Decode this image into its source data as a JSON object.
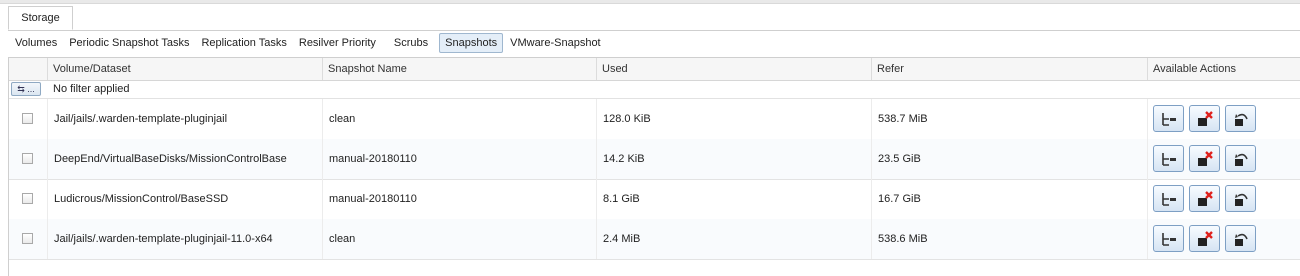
{
  "main_tab": {
    "label": "Storage"
  },
  "subtabs": [
    {
      "label": "Volumes"
    },
    {
      "label": "Periodic Snapshot Tasks"
    },
    {
      "label": "Replication Tasks"
    },
    {
      "label": "Resilver Priority"
    },
    {
      "label": "Scrubs"
    },
    {
      "label": "Snapshots",
      "active": true
    },
    {
      "label": "VMware-Snapshot"
    }
  ],
  "grid": {
    "columns": {
      "dataset": "Volume/Dataset",
      "snapshot": "Snapshot Name",
      "used": "Used",
      "refer": "Refer",
      "actions": "Available Actions"
    },
    "filter": {
      "button_label": "⇆ ...",
      "text": "No filter applied"
    },
    "rows": [
      {
        "dataset": "Jail/jails/.warden-template-pluginjail",
        "snapshot": "clean",
        "used": "128.0 KiB",
        "refer": "538.7 MiB"
      },
      {
        "dataset": "DeepEnd/VirtualBaseDisks/MissionControlBase",
        "snapshot": "manual-20180110",
        "used": "14.2 KiB",
        "refer": "23.5 GiB"
      },
      {
        "dataset": "Ludicrous/MissionControl/BaseSSD",
        "snapshot": "manual-20180110",
        "used": "8.1 GiB",
        "refer": "16.7 GiB"
      },
      {
        "dataset": "Jail/jails/.warden-template-pluginjail-11.0-x64",
        "snapshot": "clean",
        "used": "2.4 MiB",
        "refer": "538.6 MiB"
      }
    ],
    "action_icons": [
      "clone-snapshot-icon",
      "destroy-snapshot-icon",
      "rollback-snapshot-icon"
    ]
  },
  "colors": {
    "accent_border": "#7d9fc4",
    "destroy_red": "#e0201c",
    "active_tab_bg": "#e4eef8"
  }
}
